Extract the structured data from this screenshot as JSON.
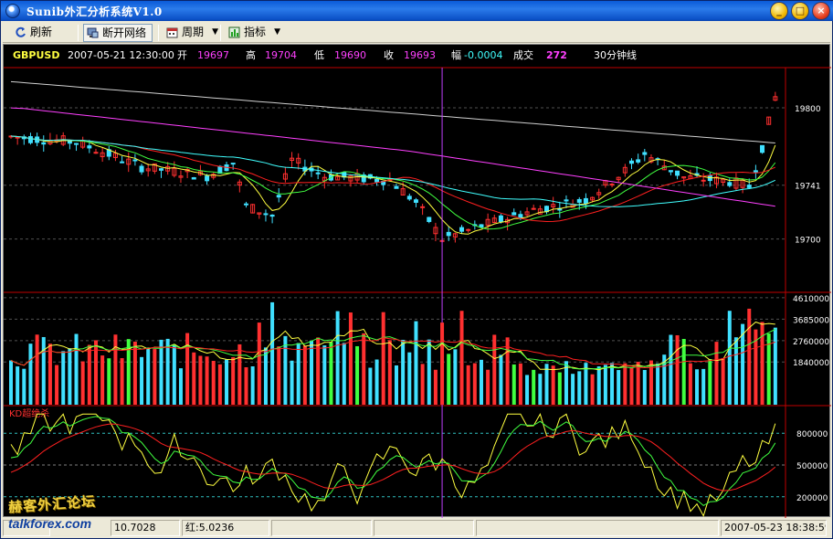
{
  "window": {
    "title": "Sunib外汇分析系统V1.0",
    "minimize_glyph": "_",
    "maximize_glyph": "□",
    "close_glyph": "×"
  },
  "toolbar": {
    "refresh_label": "刷新",
    "disconnect_label": "断开网络",
    "period_label": "周期",
    "indicator_label": "指标",
    "dropdown_glyph": "▼"
  },
  "quote": {
    "symbol": "GBPUSD",
    "datetime": "2007-05-21 12:30:00",
    "open_label": "开",
    "open": "19697",
    "high_label": "高",
    "high": "19704",
    "low_label": "低",
    "low": "19690",
    "close_label": "收",
    "close": "19693",
    "change_label": "幅",
    "change": "-0.0004",
    "volume_label": "成交",
    "volume": "272",
    "period": "30分钟线"
  },
  "price_axis": {
    "labels": [
      "19800",
      "19741",
      "19700"
    ],
    "values": [
      19800,
      19741,
      19700
    ]
  },
  "volume_axis": {
    "labels": [
      "4610000",
      "3685000",
      "2760000",
      "1840000"
    ],
    "values": [
      4610000,
      3685000,
      2760000,
      1840000
    ]
  },
  "oscillator": {
    "name": "KD超绝杀",
    "labels": [
      "800000",
      "500000",
      "200000"
    ],
    "values": [
      800000,
      500000,
      200000
    ]
  },
  "colors": {
    "up": "#ff3030",
    "down": "#40e0ff",
    "background": "#000000",
    "frame": "#c00000",
    "ma_white": "#d0d0d0",
    "ma_yellow": "#ffff40",
    "ma_magenta": "#ff40ff",
    "ma_cyan": "#40ffff",
    "ma_red": "#ff2020",
    "ma_green": "#40ff40",
    "crosshair": "#c040ff"
  },
  "status": {
    "cell1": "",
    "cell2": "10.7028",
    "cell3": "红:5.0236",
    "cell4": "",
    "cell5": "",
    "cell6": "",
    "datetime": "2007-05-23 18:38:59"
  },
  "watermark": {
    "cn": "赫客外汇论坛",
    "en": "talkforex.com"
  }
}
